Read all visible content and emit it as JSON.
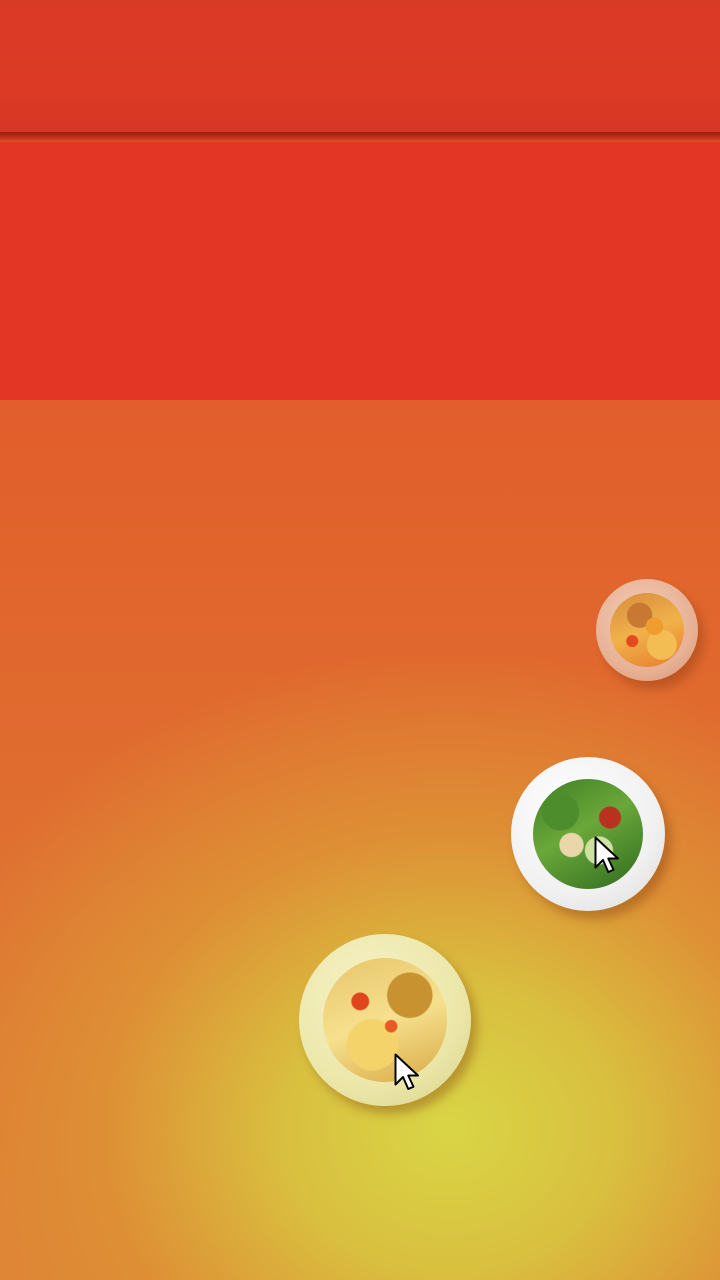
{
  "app": {
    "header": {
      "title": ""
    }
  },
  "dishes": [
    {
      "name": "",
      "icon": "tacos-dish-icon"
    },
    {
      "name": "",
      "icon": "salad-dish-icon"
    },
    {
      "name": "",
      "icon": "tacos-dish-icon"
    }
  ],
  "cursor_icon": "mouse-pointer-icon",
  "colors": {
    "header": "#d93a26",
    "banner": "#e33625",
    "background_top": "#e34c28",
    "background_glow": "#d9d546"
  }
}
